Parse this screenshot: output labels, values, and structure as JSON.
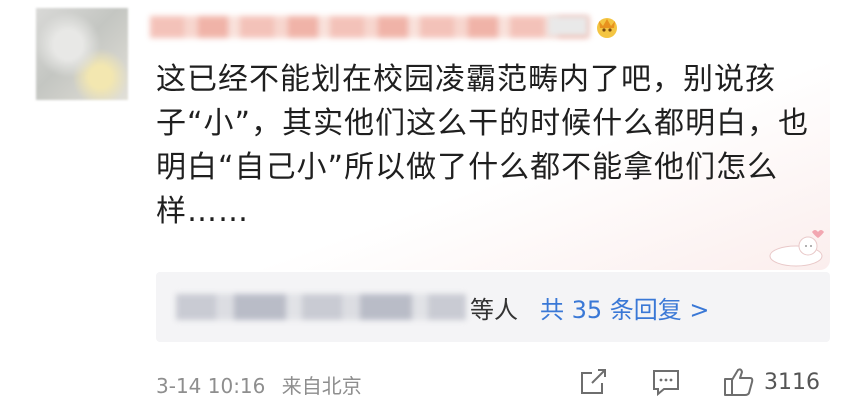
{
  "comment": {
    "text": "这已经不能划在校园凌霸范畴内了吧，别说孩子“小”，其实他们这么干的时候什么都明白，也明白“自己小”所以做了什么都不能拿他们怎么样……"
  },
  "replies": {
    "suffix": "等人",
    "count_link": "共 35 条回复 >"
  },
  "meta": {
    "date": "3-14 10:16",
    "location": "来自北京"
  },
  "actions": {
    "likes": "3116"
  },
  "colors": {
    "link": "#3a78d6",
    "meta": "#8e8e8e",
    "reply_bg": "#f4f4f6"
  },
  "icons": [
    "avatar",
    "vip-badge-icon",
    "share-icon",
    "comment-icon",
    "thumbs-up-icon",
    "sticker-decoration"
  ]
}
